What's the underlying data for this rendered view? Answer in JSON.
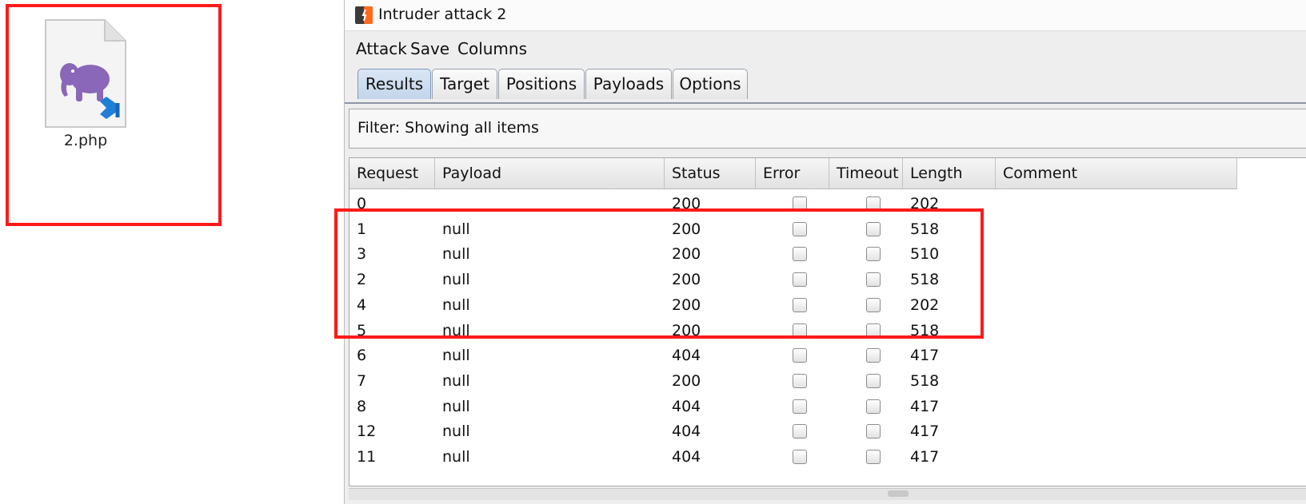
{
  "file": {
    "name": "2.php",
    "icon": "php-file-icon"
  },
  "window": {
    "title": "Intruder attack 2"
  },
  "menu": [
    "Attack",
    "Save",
    "Columns"
  ],
  "tabs": [
    {
      "label": "Results",
      "active": true
    },
    {
      "label": "Target",
      "active": false
    },
    {
      "label": "Positions",
      "active": false
    },
    {
      "label": "Payloads",
      "active": false
    },
    {
      "label": "Options",
      "active": false
    }
  ],
  "filter": {
    "text": "Filter: Showing all items"
  },
  "table": {
    "columns": [
      "Request",
      "Payload",
      "Status",
      "Error",
      "Timeout",
      "Length",
      "Comment"
    ],
    "rows": [
      {
        "request": "0",
        "payload": "",
        "status": "200",
        "error": false,
        "timeout": false,
        "length": "202",
        "comment": ""
      },
      {
        "request": "1",
        "payload": "null",
        "status": "200",
        "error": false,
        "timeout": false,
        "length": "518",
        "comment": ""
      },
      {
        "request": "3",
        "payload": "null",
        "status": "200",
        "error": false,
        "timeout": false,
        "length": "510",
        "comment": ""
      },
      {
        "request": "2",
        "payload": "null",
        "status": "200",
        "error": false,
        "timeout": false,
        "length": "518",
        "comment": ""
      },
      {
        "request": "4",
        "payload": "null",
        "status": "200",
        "error": false,
        "timeout": false,
        "length": "202",
        "comment": ""
      },
      {
        "request": "5",
        "payload": "null",
        "status": "200",
        "error": false,
        "timeout": false,
        "length": "518",
        "comment": ""
      },
      {
        "request": "6",
        "payload": "null",
        "status": "404",
        "error": false,
        "timeout": false,
        "length": "417",
        "comment": ""
      },
      {
        "request": "7",
        "payload": "null",
        "status": "200",
        "error": false,
        "timeout": false,
        "length": "518",
        "comment": ""
      },
      {
        "request": "8",
        "payload": "null",
        "status": "404",
        "error": false,
        "timeout": false,
        "length": "417",
        "comment": ""
      },
      {
        "request": "12",
        "payload": "null",
        "status": "404",
        "error": false,
        "timeout": false,
        "length": "417",
        "comment": ""
      },
      {
        "request": "11",
        "payload": "null",
        "status": "404",
        "error": false,
        "timeout": false,
        "length": "417",
        "comment": ""
      }
    ]
  },
  "colors": {
    "highlight": "#ff1a1a",
    "active_tab": "#c4d5ea",
    "php_elephant": "#8a67b8",
    "vscode_badge": "#1f7fd6"
  }
}
